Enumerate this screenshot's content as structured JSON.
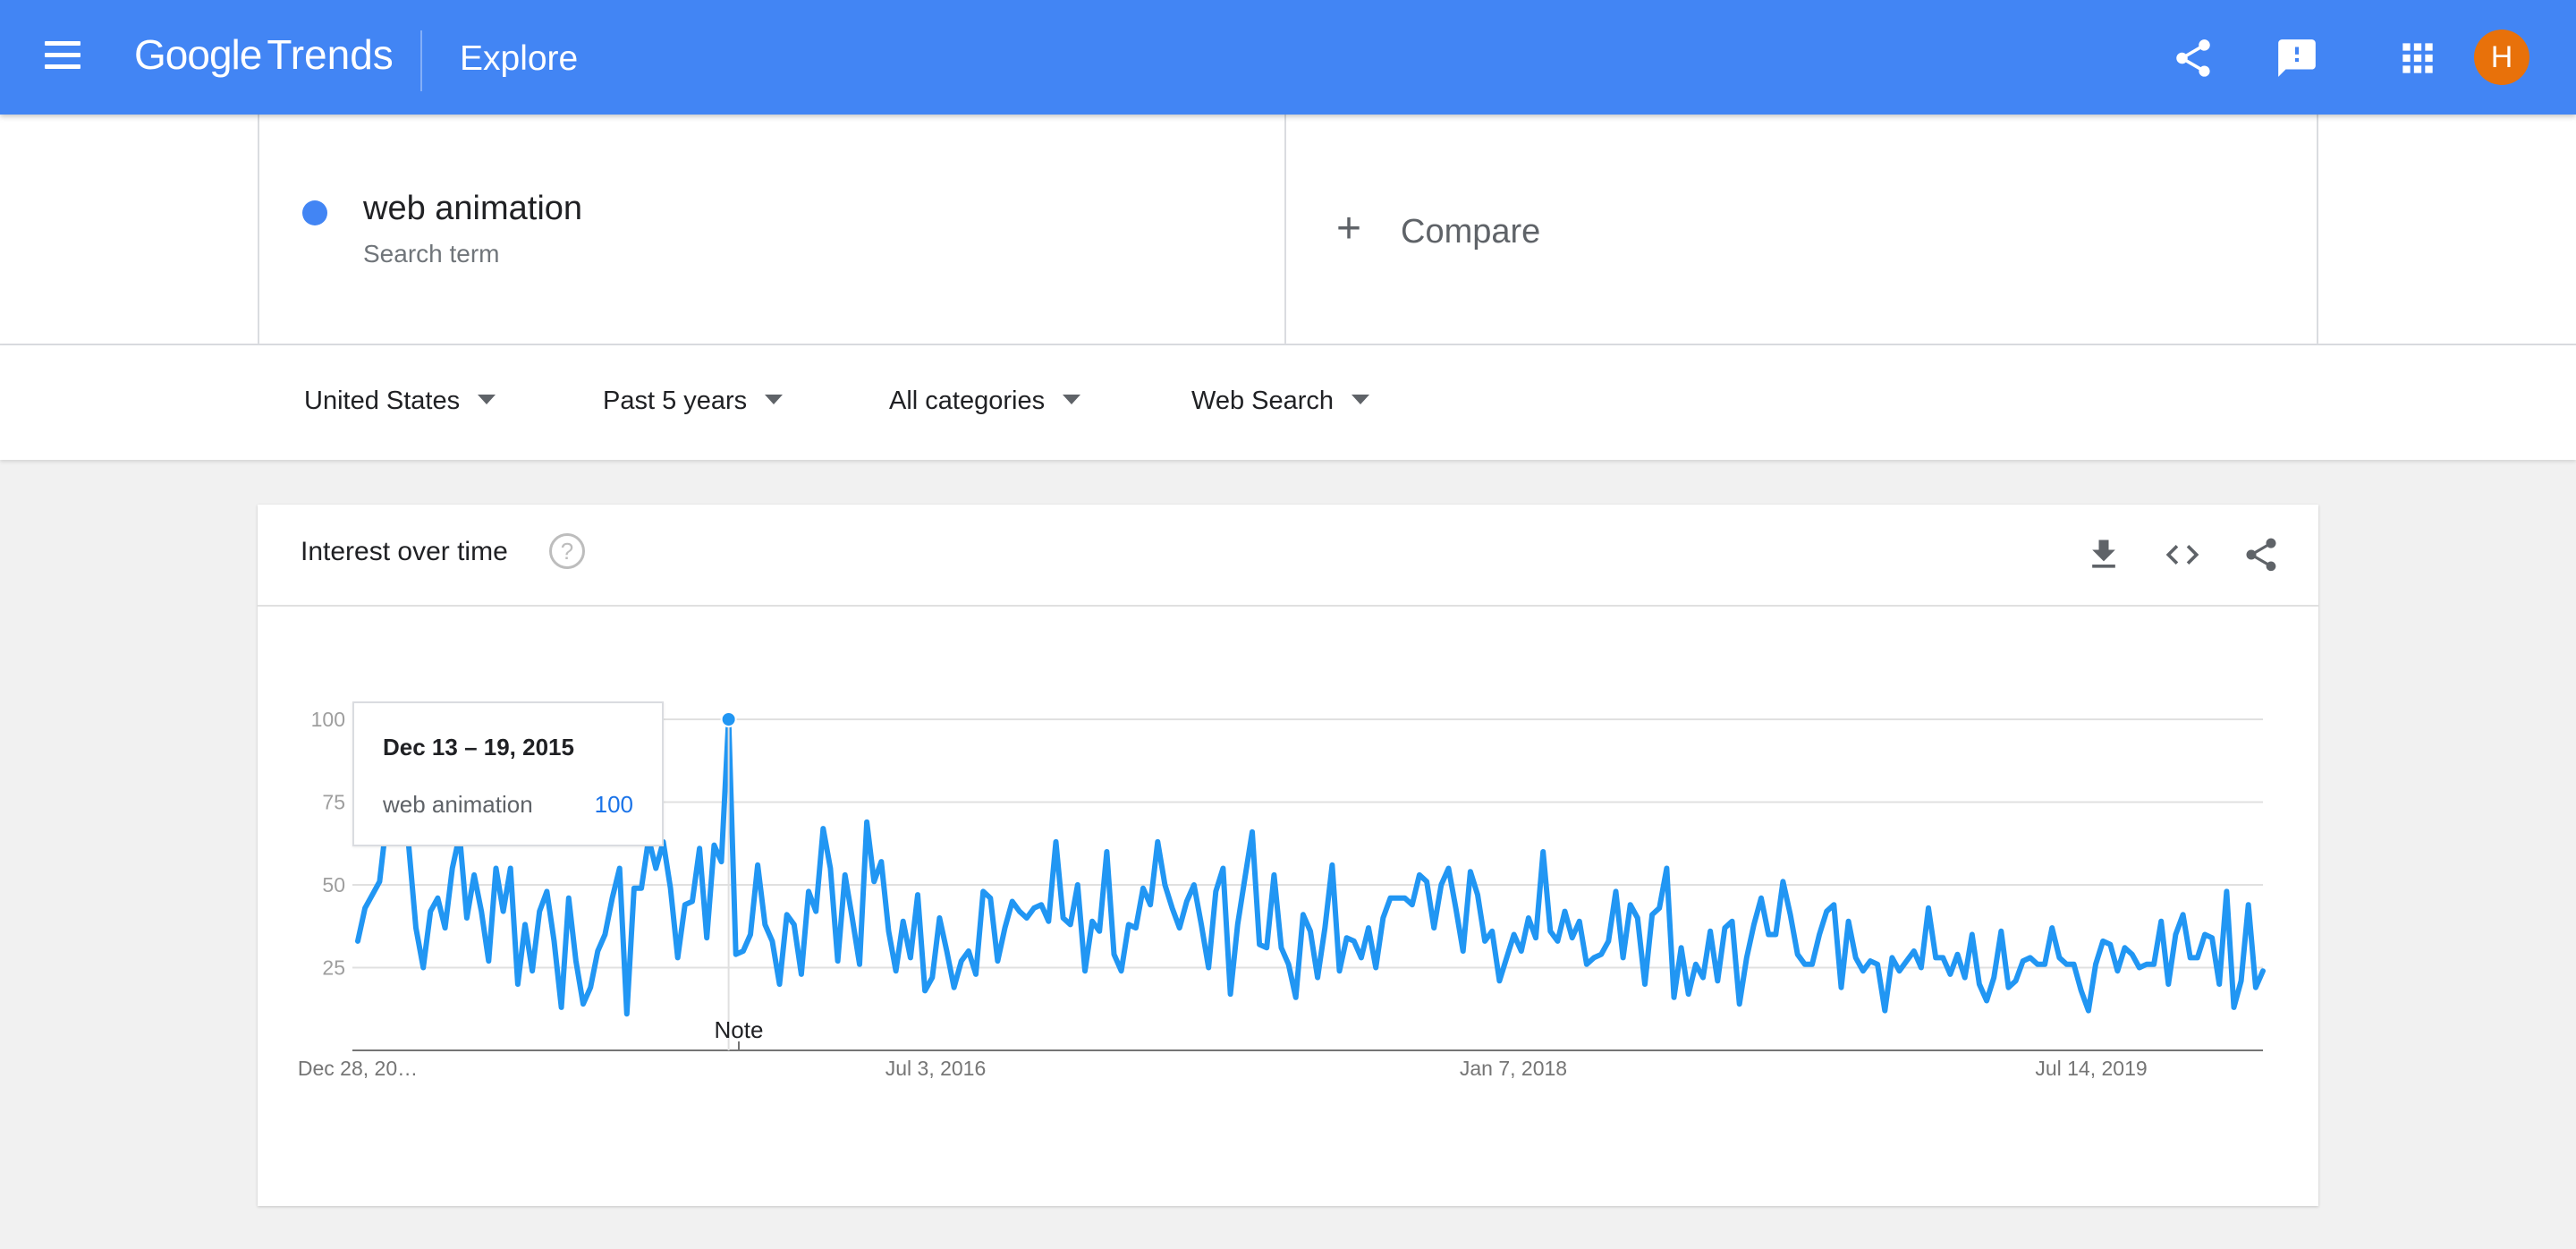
{
  "header": {
    "logo_google": "Google",
    "logo_trends": "Trends",
    "title": "Explore",
    "avatar_initial": "H",
    "icons": [
      "menu-icon",
      "share-icon",
      "feedback-icon",
      "apps-icon"
    ],
    "brand_color": "#4285f4",
    "avatar_color": "#e8710a"
  },
  "search": {
    "term": "web animation",
    "term_type": "Search term",
    "term_color": "#4285f4",
    "compare_label": "Compare"
  },
  "filters": {
    "region": "United States",
    "time_range": "Past 5 years",
    "category": "All categories",
    "property": "Web Search"
  },
  "card": {
    "title": "Interest over time",
    "icons": [
      "help-icon",
      "download-icon",
      "embed-icon",
      "share-icon"
    ]
  },
  "tooltip": {
    "date": "Dec 13 – 19, 2015",
    "term": "web animation",
    "value": "100"
  },
  "chart_data": {
    "type": "line",
    "ylim": [
      0,
      100
    ],
    "yticks": [
      "100",
      "75",
      "50",
      "25"
    ],
    "xtick_labels": [
      "Dec 28, 20…",
      "Jul 3, 2016",
      "Jan 7, 2018",
      "Jul 14, 2019"
    ],
    "annotation": "Note",
    "grid": true,
    "line_color": "#2196f3",
    "series": [
      {
        "name": "web animation",
        "values": [
          33,
          43,
          47,
          51,
          70,
          72,
          68,
          62,
          37,
          25,
          42,
          46,
          37,
          55,
          65,
          40,
          53,
          42,
          27,
          55,
          42,
          55,
          20,
          38,
          24,
          42,
          48,
          33,
          13,
          46,
          27,
          14,
          19,
          30,
          35,
          46,
          55,
          11,
          49,
          49,
          64,
          55,
          63,
          49,
          28,
          44,
          45,
          61,
          34,
          62,
          57,
          100,
          29,
          30,
          35,
          56,
          38,
          33,
          20,
          41,
          38,
          23,
          48,
          42,
          67,
          55,
          27,
          53,
          40,
          26,
          69,
          51,
          57,
          36,
          24,
          39,
          28,
          47,
          18,
          22,
          40,
          30,
          19,
          27,
          30,
          23,
          48,
          46,
          27,
          37,
          45,
          42,
          40,
          43,
          44,
          39,
          63,
          40,
          38,
          50,
          24,
          39,
          36,
          60,
          29,
          24,
          38,
          37,
          49,
          44,
          63,
          50,
          43,
          37,
          45,
          50,
          38,
          25,
          48,
          55,
          17,
          38,
          52,
          66,
          32,
          31,
          53,
          31,
          26,
          16,
          41,
          36,
          22,
          37,
          56,
          24,
          34,
          33,
          28,
          37,
          25,
          40,
          46,
          46,
          46,
          44,
          53,
          51,
          37,
          50,
          55,
          43,
          30,
          54,
          47,
          33,
          36,
          21,
          28,
          35,
          30,
          40,
          34,
          60,
          36,
          33,
          42,
          34,
          39,
          26,
          28,
          29,
          33,
          48,
          28,
          44,
          40,
          20,
          41,
          43,
          55,
          16,
          31,
          17,
          26,
          22,
          36,
          21,
          37,
          39,
          14,
          28,
          38,
          46,
          35,
          35,
          51,
          41,
          29,
          26,
          26,
          35,
          42,
          44,
          19,
          39,
          28,
          24,
          27,
          26,
          12,
          28,
          24,
          27,
          30,
          25,
          43,
          28,
          28,
          23,
          29,
          22,
          35,
          20,
          15,
          22,
          36,
          19,
          21,
          27,
          28,
          26,
          26,
          37,
          28,
          26,
          26,
          18,
          12,
          26,
          33,
          32,
          24,
          31,
          29,
          25,
          26,
          26,
          39,
          20,
          35,
          41,
          28,
          28,
          35,
          34,
          20,
          48,
          13,
          21,
          44,
          19,
          24
        ]
      }
    ]
  }
}
